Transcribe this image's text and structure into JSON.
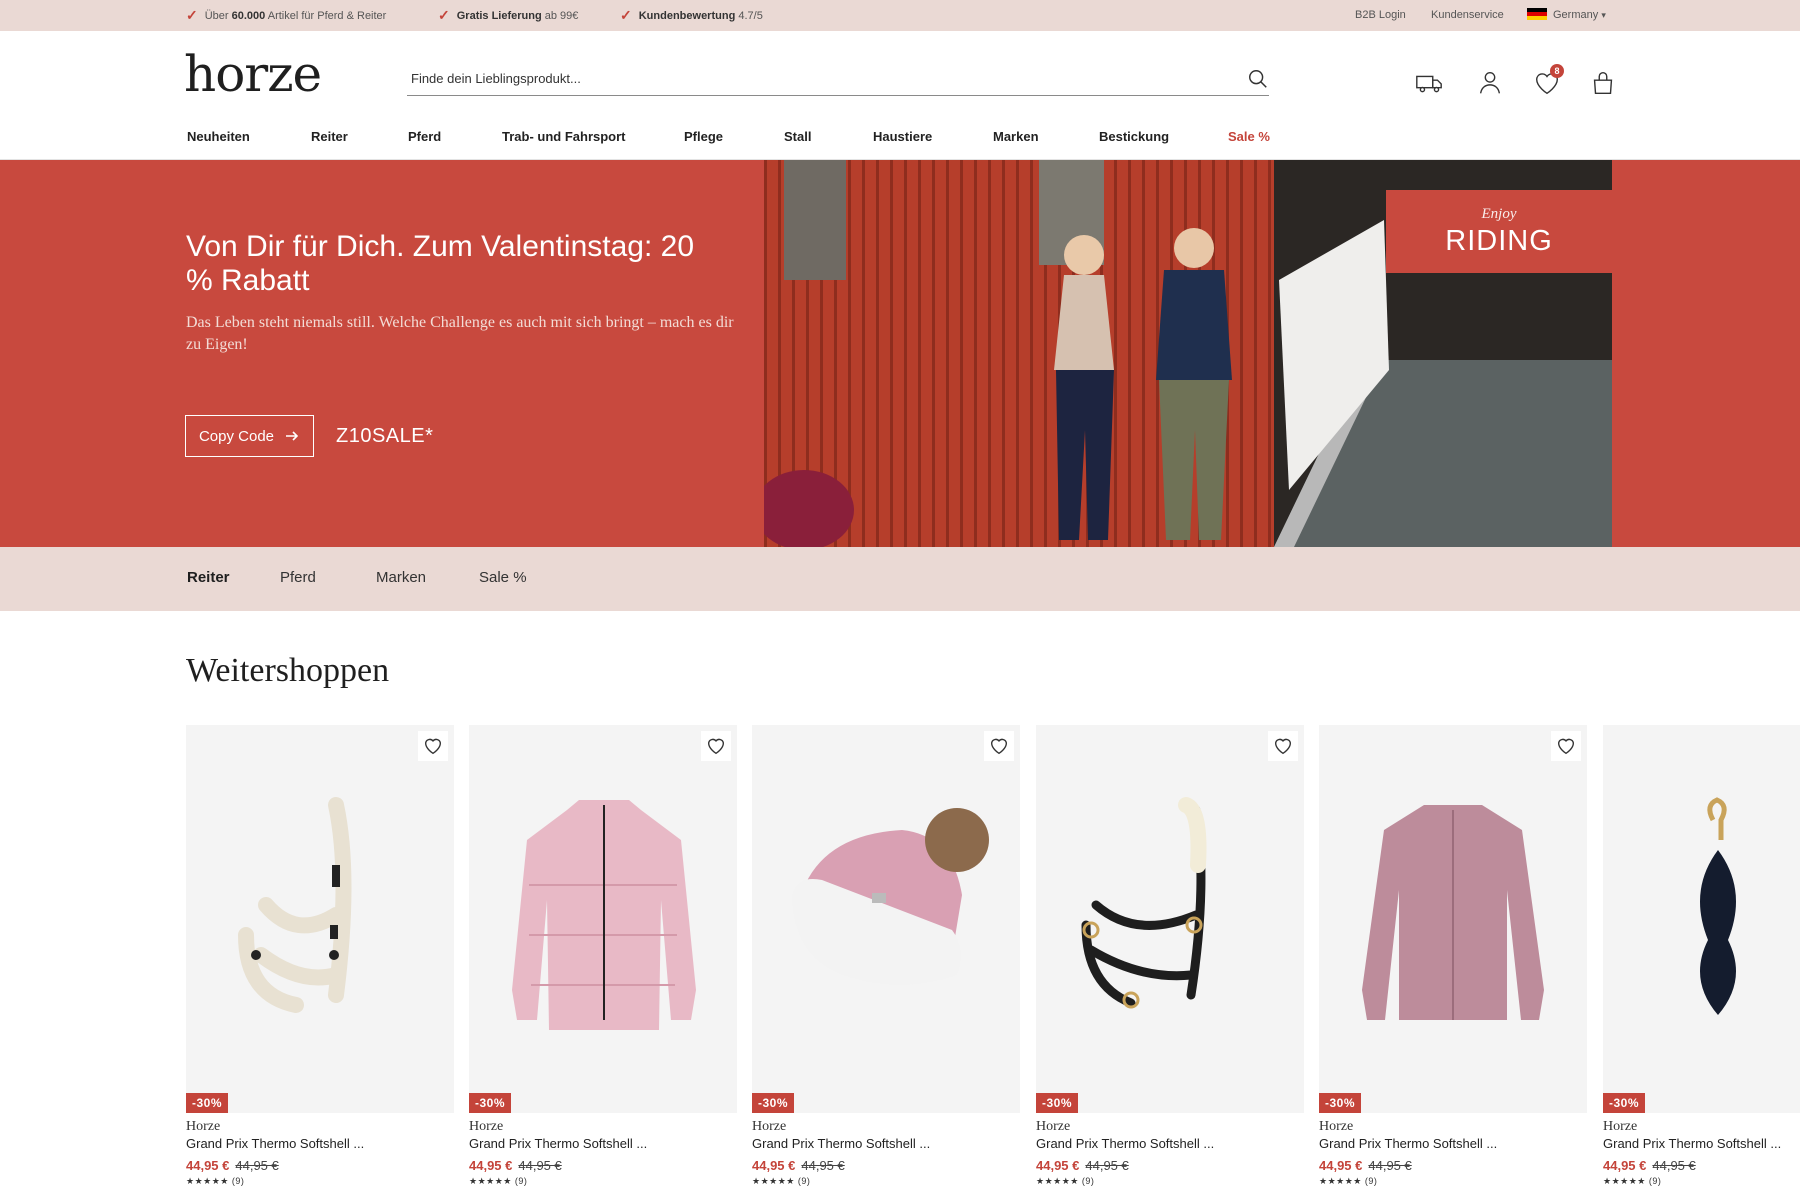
{
  "topbar": {
    "usp1_pre": "Über ",
    "usp1_bold": "60.000",
    "usp1_post": " Artikel für Pferd & Reiter",
    "usp2_bold": "Gratis Lieferung",
    "usp2_post": " ab 99€",
    "usp3_bold": "Kundenbewertung",
    "usp3_post": " 4.7/5",
    "b2b": "B2B Login",
    "service": "Kundenservice",
    "country": "Germany"
  },
  "header": {
    "logo": "horze",
    "search_placeholder": "Finde dein Lieblingsprodukt...",
    "wishlist_count": "8"
  },
  "nav": {
    "items": [
      "Neuheiten",
      "Reiter",
      "Pferd",
      "Trab- und Fahrsport",
      "Pflege",
      "Stall",
      "Haustiere",
      "Marken",
      "Bestickung",
      "Sale %"
    ]
  },
  "hero": {
    "title": "Von Dir für Dich. Zum Valentinstag: 20 % Rabatt",
    "text": "Das Leben steht niemals still. Welche Challenge es auch mit sich bringt – mach es dir zu Eigen!",
    "button": "Copy Code",
    "code": "Z10SALE*",
    "enjoy": "Enjoy",
    "riding": "RIDING",
    "colors": {
      "background": "#c8493e",
      "barn": "#b63e2b"
    }
  },
  "subnav": {
    "items": [
      "Reiter",
      "Pferd",
      "Marken",
      "Sale %"
    ]
  },
  "section": {
    "title": "Weitershoppen"
  },
  "products": [
    {
      "image": "halter-icon",
      "discount": "-30%",
      "brand": "Horze",
      "name": "Grand Prix Thermo Softshell ...",
      "price": "44,95 €",
      "old_price": "44,95 €",
      "stars": "★★★★★",
      "reviews": "(9)"
    },
    {
      "image": "puffer-jacket-icon",
      "discount": "-30%",
      "brand": "Horze",
      "name": "Grand Prix Thermo Softshell ...",
      "price": "44,95 €",
      "old_price": "44,95 €",
      "stars": "★★★★★",
      "reviews": "(9)"
    },
    {
      "image": "beanie-icon",
      "discount": "-30%",
      "brand": "Horze",
      "name": "Grand Prix Thermo Softshell ...",
      "price": "44,95 €",
      "old_price": "44,95 €",
      "stars": "★★★★★",
      "reviews": "(9)"
    },
    {
      "image": "halter-icon",
      "discount": "-30%",
      "brand": "Horze",
      "name": "Grand Prix Thermo Softshell ...",
      "price": "44,95 €",
      "old_price": "44,95 €",
      "stars": "★★★★★",
      "reviews": "(9)"
    },
    {
      "image": "jacket-icon",
      "discount": "-30%",
      "brand": "Horze",
      "name": "Grand Prix Thermo Softshell ...",
      "price": "44,95 €",
      "old_price": "44,95 €",
      "stars": "★★★★★",
      "reviews": "(9)"
    },
    {
      "image": "lead-rope-icon",
      "discount": "-30%",
      "brand": "Horze",
      "name": "Grand Prix Thermo Softshell ...",
      "price": "44,95 €",
      "old_price": "44,95 €",
      "stars": "★★★★★",
      "reviews": "(9)"
    }
  ]
}
